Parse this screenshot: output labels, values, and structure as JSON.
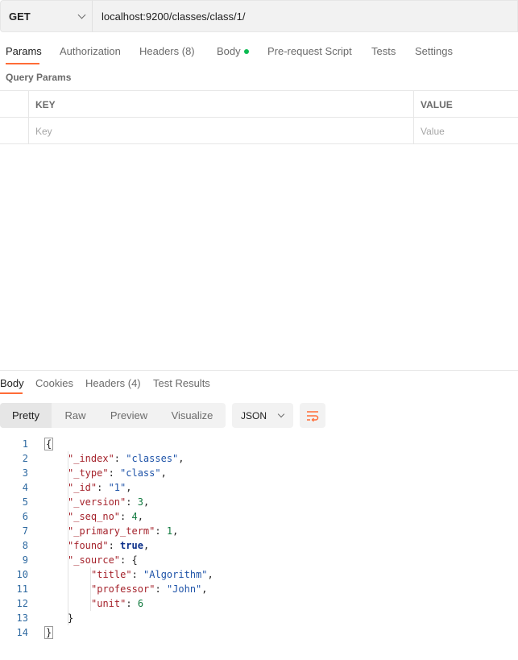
{
  "request": {
    "method": "GET",
    "url": "localhost:9200/classes/class/1/"
  },
  "request_tabs": [
    {
      "label": "Params",
      "active": true
    },
    {
      "label": "Authorization"
    },
    {
      "label": "Headers (8)"
    },
    {
      "label": "Body"
    },
    {
      "label": "Pre-request Script"
    },
    {
      "label": "Tests"
    },
    {
      "label": "Settings"
    }
  ],
  "query_params": {
    "section_label": "Query Params",
    "col_key": "KEY",
    "col_value": "VALUE",
    "key_placeholder": "Key",
    "value_placeholder": "Value"
  },
  "response_tabs": [
    {
      "label": "Body",
      "active": true
    },
    {
      "label": "Cookies"
    },
    {
      "label": "Headers (4)"
    },
    {
      "label": "Test Results"
    }
  ],
  "view_modes": [
    "Pretty",
    "Raw",
    "Preview",
    "Visualize"
  ],
  "format": "JSON",
  "colors": {
    "accent": "#ff6c37",
    "body_dot": "#0cbb52",
    "json_key": "#a5232c",
    "json_string": "#1e53a8",
    "json_number": "#117a3f",
    "json_bool": "#0b2f8a"
  },
  "icons": [
    "chevron-down-icon",
    "wrap-lines-icon"
  ],
  "response_lines": [
    {
      "n": "1",
      "indent": 0,
      "open": "{"
    },
    {
      "n": "2",
      "indent": 1,
      "key": "\"_index\"",
      "val": "\"classes\"",
      "type": "s",
      "comma": ","
    },
    {
      "n": "3",
      "indent": 1,
      "key": "\"_type\"",
      "val": "\"class\"",
      "type": "s",
      "comma": ","
    },
    {
      "n": "4",
      "indent": 1,
      "key": "\"_id\"",
      "val": "\"1\"",
      "type": "s",
      "comma": ","
    },
    {
      "n": "5",
      "indent": 1,
      "key": "\"_version\"",
      "val": "3",
      "type": "n",
      "comma": ","
    },
    {
      "n": "6",
      "indent": 1,
      "key": "\"_seq_no\"",
      "val": "4",
      "type": "n",
      "comma": ","
    },
    {
      "n": "7",
      "indent": 1,
      "key": "\"_primary_term\"",
      "val": "1",
      "type": "n",
      "comma": ","
    },
    {
      "n": "8",
      "indent": 1,
      "key": "\"found\"",
      "val": "true",
      "type": "b",
      "comma": ","
    },
    {
      "n": "9",
      "indent": 1,
      "key": "\"_source\"",
      "val": "{",
      "type": "p",
      "comma": ""
    },
    {
      "n": "10",
      "indent": 2,
      "key": "\"title\"",
      "val": "\"Algorithm\"",
      "type": "s",
      "comma": ","
    },
    {
      "n": "11",
      "indent": 2,
      "key": "\"professor\"",
      "val": "\"John\"",
      "type": "s",
      "comma": ","
    },
    {
      "n": "12",
      "indent": 2,
      "key": "\"unit\"",
      "val": "6",
      "type": "n",
      "comma": ""
    },
    {
      "n": "13",
      "indent": 1,
      "open": "}"
    },
    {
      "n": "14",
      "indent": 0,
      "open": "}"
    }
  ]
}
